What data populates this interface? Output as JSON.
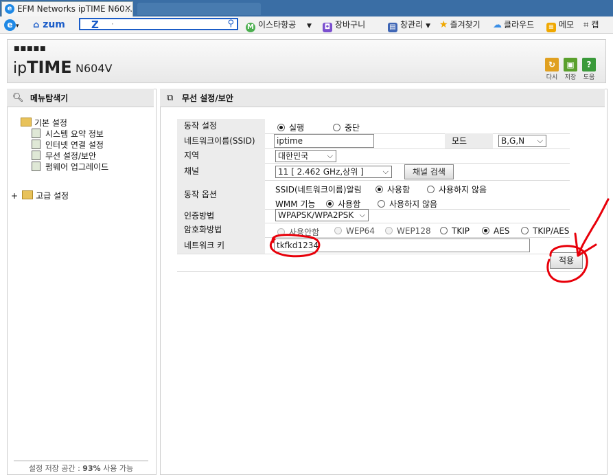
{
  "browser": {
    "tab_title": "EFM Networks ipTIME N60...",
    "tab_close": "×",
    "toolbar": {
      "home_label": "zum",
      "search_logo": "Z",
      "search_placeholder": "·",
      "bookmarks": [
        {
          "label": "이스타항공",
          "icon": "green-m-icon",
          "color": "#4caf50"
        },
        {
          "label": "장바구니",
          "icon": "shopping-bag-icon",
          "color": "#7b4fcf"
        },
        {
          "label": "창관리",
          "icon": "window-icon",
          "color": "#3f66b5"
        },
        {
          "label": "즐겨찾기",
          "icon": "star-icon",
          "color": "#f0a800"
        },
        {
          "label": "클라우드",
          "icon": "cloud-icon",
          "color": "#3a8ee6"
        },
        {
          "label": "메모",
          "icon": "memo-icon",
          "color": "#f0a800"
        },
        {
          "label": "캡",
          "icon": "crop-icon",
          "color": "#333333"
        }
      ]
    }
  },
  "header": {
    "logo_dots": "■■■■■",
    "logo_ip": "ip",
    "logo_time": "TIME",
    "model": "N604V",
    "buttons": [
      {
        "label": "다시",
        "icon": "refresh-icon",
        "color": "#e0a020",
        "glyph": "↻"
      },
      {
        "label": "저장",
        "icon": "save-icon",
        "color": "#5aa02c",
        "glyph": "▣"
      },
      {
        "label": "도움",
        "icon": "help-icon",
        "color": "#3a9a3a",
        "glyph": "?"
      }
    ]
  },
  "menu": {
    "title": "메뉴탐색기",
    "basic_settings": "기본 설정",
    "items": [
      "시스템 요약 정보",
      "인터넷 연결 설정",
      "무선 설정/보안",
      "펌웨어 업그레이드"
    ],
    "advanced_expander": "+",
    "advanced_settings": "고급 설정",
    "storage_prefix": "설정 저장 공간 : ",
    "storage_percent": "93%",
    "storage_suffix": " 사용 가능"
  },
  "wireless": {
    "title": "무선 설정/보안",
    "operation_label": "동작 설정",
    "operation_options": [
      "실행",
      "중단"
    ],
    "operation_selected": "실행",
    "ssid_label": "네트워크이름(SSID)",
    "ssid_value": "iptime",
    "mode_label": "모드",
    "mode_value": "B,G,N",
    "region_label": "지역",
    "region_value": "대한민국",
    "channel_label": "채널",
    "channel_value": "11 [ 2.462 GHz,상위 ]",
    "channel_search": "채널 검색",
    "options_label": "동작 옵션",
    "ssid_broadcast_label": "SSID(네트워크이름)알림",
    "ssid_broadcast_options": [
      "사용함",
      "사용하지 않음"
    ],
    "ssid_broadcast_selected": "사용함",
    "wmm_label": "WMM 기능",
    "wmm_options": [
      "사용함",
      "사용하지 않음"
    ],
    "wmm_selected": "사용함",
    "auth_label": "인증방법",
    "auth_value": "WPAPSK/WPA2PSK",
    "encryption_label": "암호화방법",
    "encryption_options": [
      "사용안함",
      "WEP64",
      "WEP128",
      "TKIP",
      "AES",
      "TKIP/AES"
    ],
    "encryption_selected": "AES",
    "key_label": "네트워크 키",
    "key_value": "tkfkd1234",
    "apply_label": "적용"
  },
  "annotation": {
    "color": "#e8000a"
  }
}
